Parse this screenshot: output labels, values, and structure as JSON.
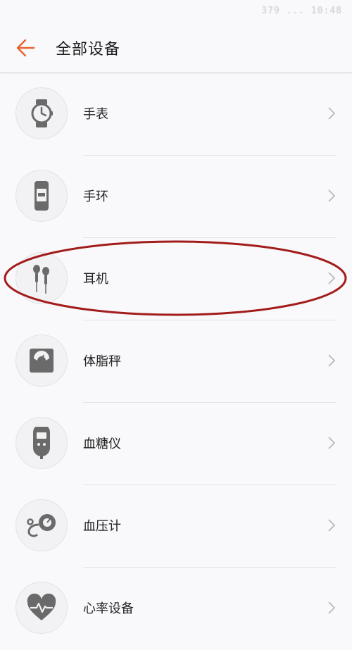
{
  "status_bar": {
    "text": "379 ... 10:48"
  },
  "header": {
    "title": "全部设备"
  },
  "devices": [
    {
      "label": "手表",
      "icon": "watch-icon"
    },
    {
      "label": "手环",
      "icon": "band-icon"
    },
    {
      "label": "耳机",
      "icon": "earphones-icon"
    },
    {
      "label": "体脂秤",
      "icon": "body-scale-icon"
    },
    {
      "label": "血糖仪",
      "icon": "glucose-meter-icon"
    },
    {
      "label": "血压计",
      "icon": "blood-pressure-icon"
    },
    {
      "label": "心率设备",
      "icon": "heart-rate-icon"
    }
  ],
  "colors": {
    "accent": "#e8622c",
    "annotation": "#a31c1c",
    "icon": "#6a6a6a"
  }
}
